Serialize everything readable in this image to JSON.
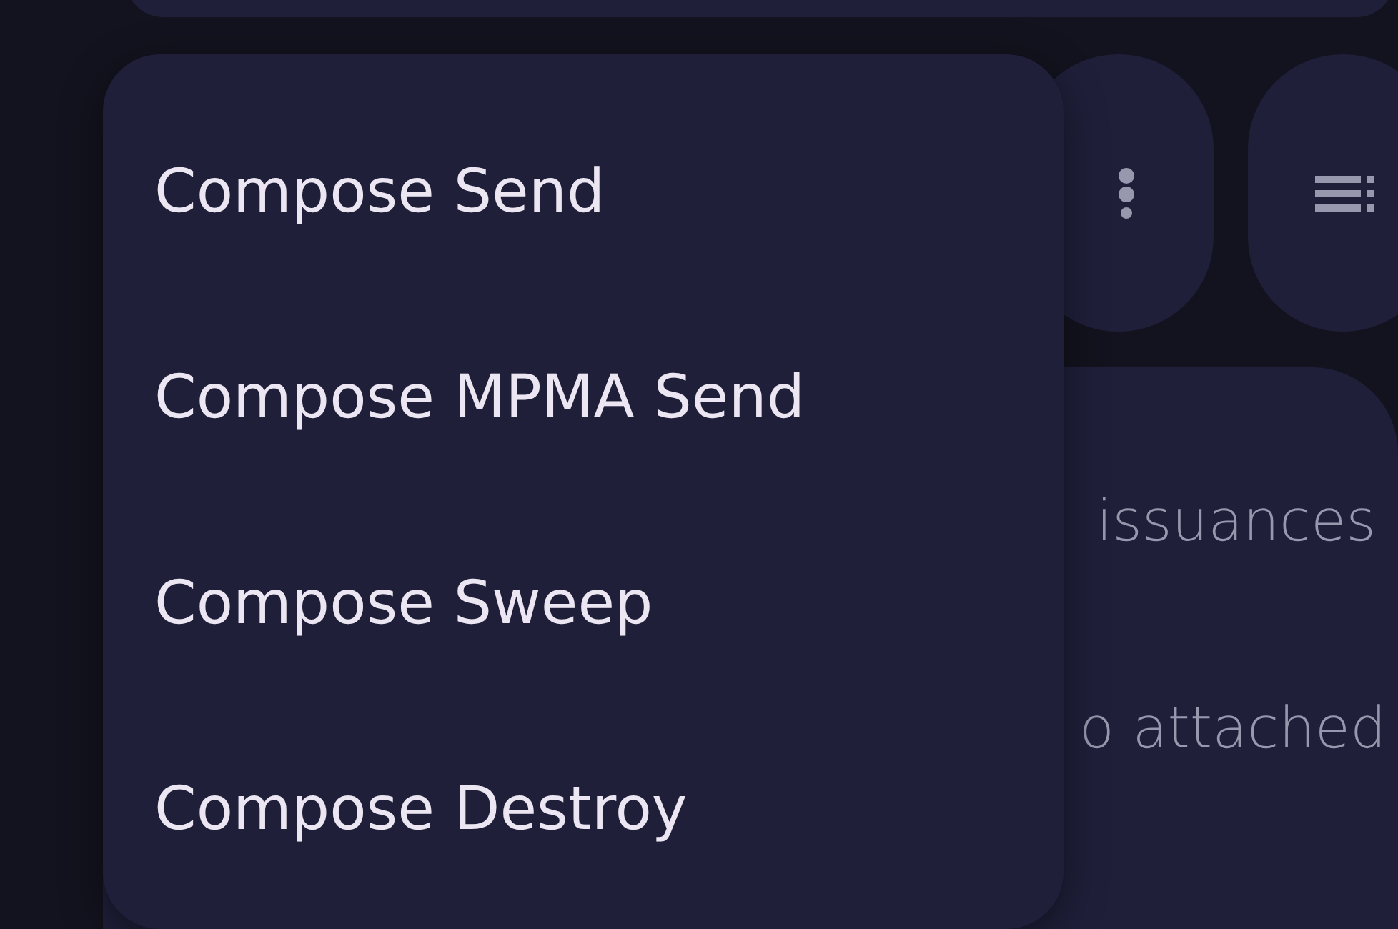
{
  "menu": {
    "items": [
      {
        "label": "Compose Send"
      },
      {
        "label": "Compose MPMA Send"
      },
      {
        "label": "Compose Sweep"
      },
      {
        "label": "Compose Destroy"
      }
    ]
  },
  "card": {
    "lines": [
      "issuances",
      "o attached"
    ]
  }
}
